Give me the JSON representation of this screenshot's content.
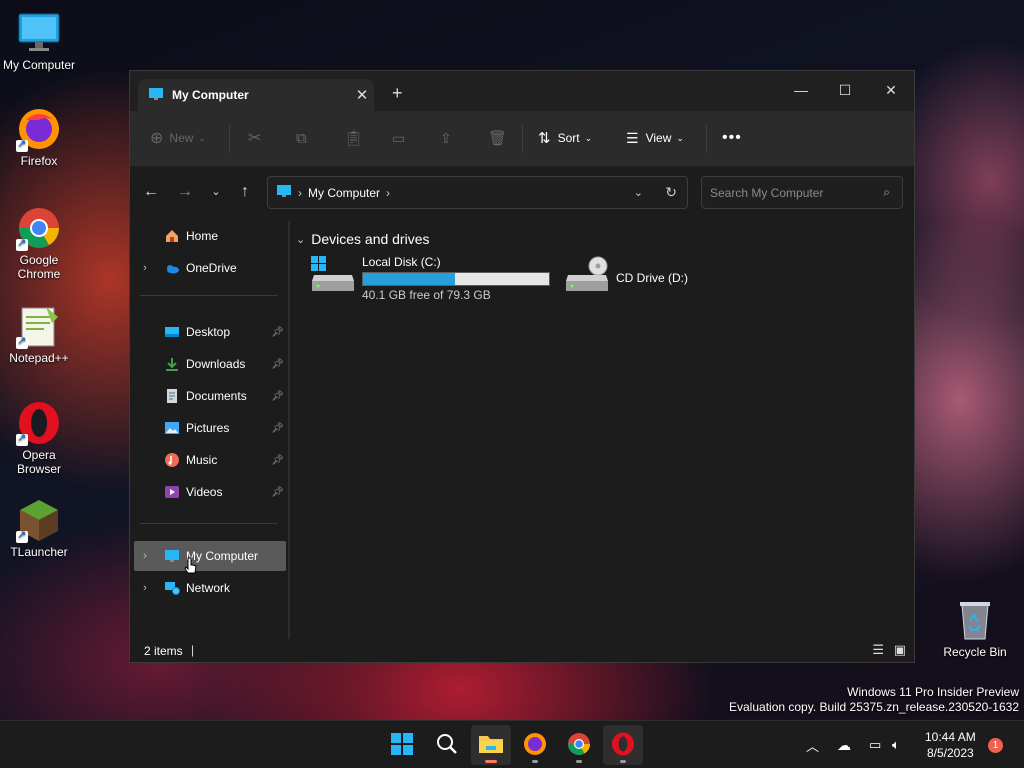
{
  "desktop": {
    "icons": [
      {
        "label": "My Computer"
      },
      {
        "label": "Firefox"
      },
      {
        "label": "Google Chrome"
      },
      {
        "label": "Notepad++"
      },
      {
        "label": "Opera Browser"
      },
      {
        "label": "TLauncher"
      },
      {
        "label": "Recycle Bin"
      }
    ],
    "watermark": {
      "line1": "Windows 11 Pro Insider Preview",
      "line2": "Evaluation copy. Build 25375.zn_release.230520-1632"
    }
  },
  "window": {
    "tab_title": "My Computer",
    "toolbar": {
      "new_label": "New",
      "sort_label": "Sort",
      "view_label": "View"
    },
    "address": {
      "crumb": "My Computer"
    },
    "search": {
      "placeholder": "Search My Computer"
    },
    "sidebar": {
      "home": "Home",
      "onedrive": "OneDrive",
      "pinned": [
        "Desktop",
        "Downloads",
        "Documents",
        "Pictures",
        "Music",
        "Videos"
      ],
      "my_computer": "My Computer",
      "network": "Network"
    },
    "content": {
      "group_title": "Devices and drives",
      "drives": [
        {
          "name": "Local Disk (C:)",
          "free_text": "40.1 GB free of 79.3 GB",
          "used_fraction": 0.494
        },
        {
          "name": "CD Drive (D:)"
        }
      ]
    },
    "status": {
      "items": "2 items"
    }
  },
  "taskbar": {
    "time": "10:44 AM",
    "date": "8/5/2023",
    "notification_count": "1"
  },
  "colors": {
    "accent": "#26a0da",
    "window_bg": "#1c1c1c",
    "toolbar_bg": "#2b2b2b",
    "selected_bg": "#5a5a5a"
  }
}
